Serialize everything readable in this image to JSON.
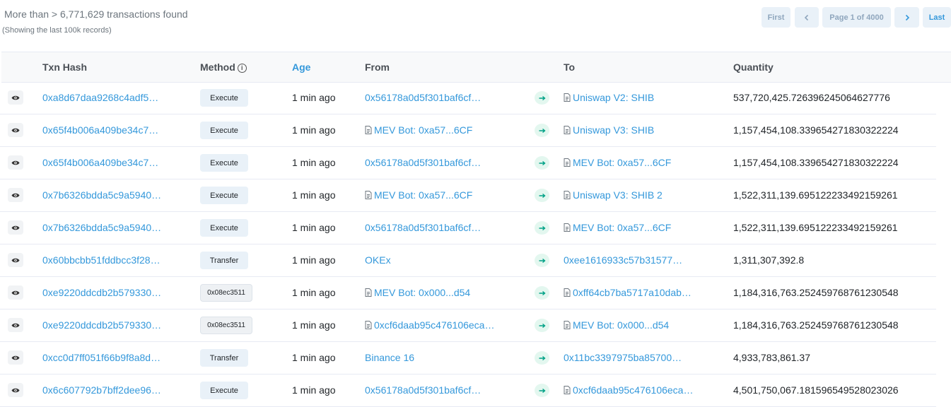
{
  "summary": {
    "text": "More than > 6,771,629 transactions found",
    "subtext": "(Showing the last 100k records)"
  },
  "pager": {
    "first": "First",
    "page": "Page 1 of 4000",
    "last": "Last"
  },
  "table": {
    "headers": {
      "hash": "Txn Hash",
      "method": "Method",
      "age": "Age",
      "from": "From",
      "to": "To",
      "quantity": "Quantity"
    },
    "rows": [
      {
        "hash": "0xa8d67daa9268c4adf5…",
        "method": "Execute",
        "age": "1 min ago",
        "from": "0x56178a0d5f301baf6cf…",
        "to": "Uniswap V2: SHIB",
        "qty": "537,720,425.726396245064627776"
      },
      {
        "hash": "0x65f4b006a409be34c7…",
        "method": "Execute",
        "age": "1 min ago",
        "from": "MEV Bot: 0xa57...6CF",
        "to": "Uniswap V3: SHIB",
        "qty": "1,157,454,108.339654271830322224"
      },
      {
        "hash": "0x65f4b006a409be34c7…",
        "method": "Execute",
        "age": "1 min ago",
        "from": "0x56178a0d5f301baf6cf…",
        "to": "MEV Bot: 0xa57...6CF",
        "qty": "1,157,454,108.339654271830322224"
      },
      {
        "hash": "0x7b6326bdda5c9a5940…",
        "method": "Execute",
        "age": "1 min ago",
        "from": "MEV Bot: 0xa57...6CF",
        "to": "Uniswap V3: SHIB 2",
        "qty": "1,522,311,139.695122233492159261"
      },
      {
        "hash": "0x7b6326bdda5c9a5940…",
        "method": "Execute",
        "age": "1 min ago",
        "from": "0x56178a0d5f301baf6cf…",
        "to": "MEV Bot: 0xa57...6CF",
        "qty": "1,522,311,139.695122233492159261"
      },
      {
        "hash": "0x60bbcbb51fddbcc3f28…",
        "method": "Transfer",
        "age": "1 min ago",
        "from": "OKEx",
        "to": "0xee1616933c57b31577…",
        "qty": "1,311,307,392.8"
      },
      {
        "hash": "0xe9220ddcdb2b579330…",
        "method": "0x08ec3511",
        "age": "1 min ago",
        "from": "MEV Bot: 0x000...d54",
        "to": "0xff64cb7ba5717a10dab…",
        "qty": "1,184,316,763.252459768761230548"
      },
      {
        "hash": "0xe9220ddcdb2b579330…",
        "method": "0x08ec3511",
        "age": "1 min ago",
        "from": "0xcf6daab95c476106eca…",
        "to": "MEV Bot: 0x000...d54",
        "qty": "1,184,316,763.252459768761230548"
      },
      {
        "hash": "0xcc0d7ff051f66b9f8a8d…",
        "method": "Transfer",
        "age": "1 min ago",
        "from": "Binance 16",
        "to": "0x11bc3397975ba85700…",
        "qty": "4,933,783,861.37"
      },
      {
        "hash": "0x6c607792b7bff2dee96…",
        "method": "Execute",
        "age": "1 min ago",
        "from": "0x56178a0d5f301baf6cf…",
        "to": "0xcf6daab95c476106eca…",
        "qty": "4,501,750,067.181596549528023026"
      }
    ]
  },
  "colors": {
    "link": "#3498db",
    "arrow_bg": "#e3f7ef",
    "arrow": "#00a186"
  },
  "icons": {
    "eye": "eye-icon",
    "info": "info-circle-icon",
    "contract": "file-icon",
    "direction": "arrow-right-icon",
    "prev": "chevron-left-icon",
    "next": "chevron-right-icon"
  }
}
